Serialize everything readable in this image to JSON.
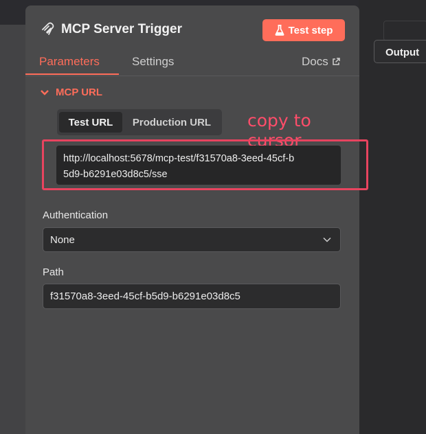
{
  "node": {
    "title": "MCP Server Trigger",
    "test_step_label": "Test step"
  },
  "tabs": {
    "parameters": "Parameters",
    "settings": "Settings",
    "docs": "Docs"
  },
  "output_label": "Output",
  "mcp_url": {
    "section_label": "MCP URL",
    "test_url_label": "Test URL",
    "production_url_label": "Production URL",
    "url_line1": "http://localhost:5678/mcp-test/f31570a8-3eed-45cf-b",
    "url_line2": "5d9-b6291e03d8c5/sse"
  },
  "annotation": {
    "text": "copy to cursor",
    "color": "#ff4d6a"
  },
  "authentication": {
    "label": "Authentication",
    "value": "None"
  },
  "path": {
    "label": "Path",
    "value": "f31570a8-3eed-45cf-b5d9-b6291e03d8c5"
  },
  "colors": {
    "accent": "#ff6d5a",
    "panel": "#4a4a4b",
    "field": "#2c2c2d"
  },
  "icons": {
    "node": "mcp-logo-icon",
    "test_step": "flask-icon",
    "docs": "external-link-icon",
    "section": "chevron-down-icon",
    "select": "chevron-down-icon"
  }
}
